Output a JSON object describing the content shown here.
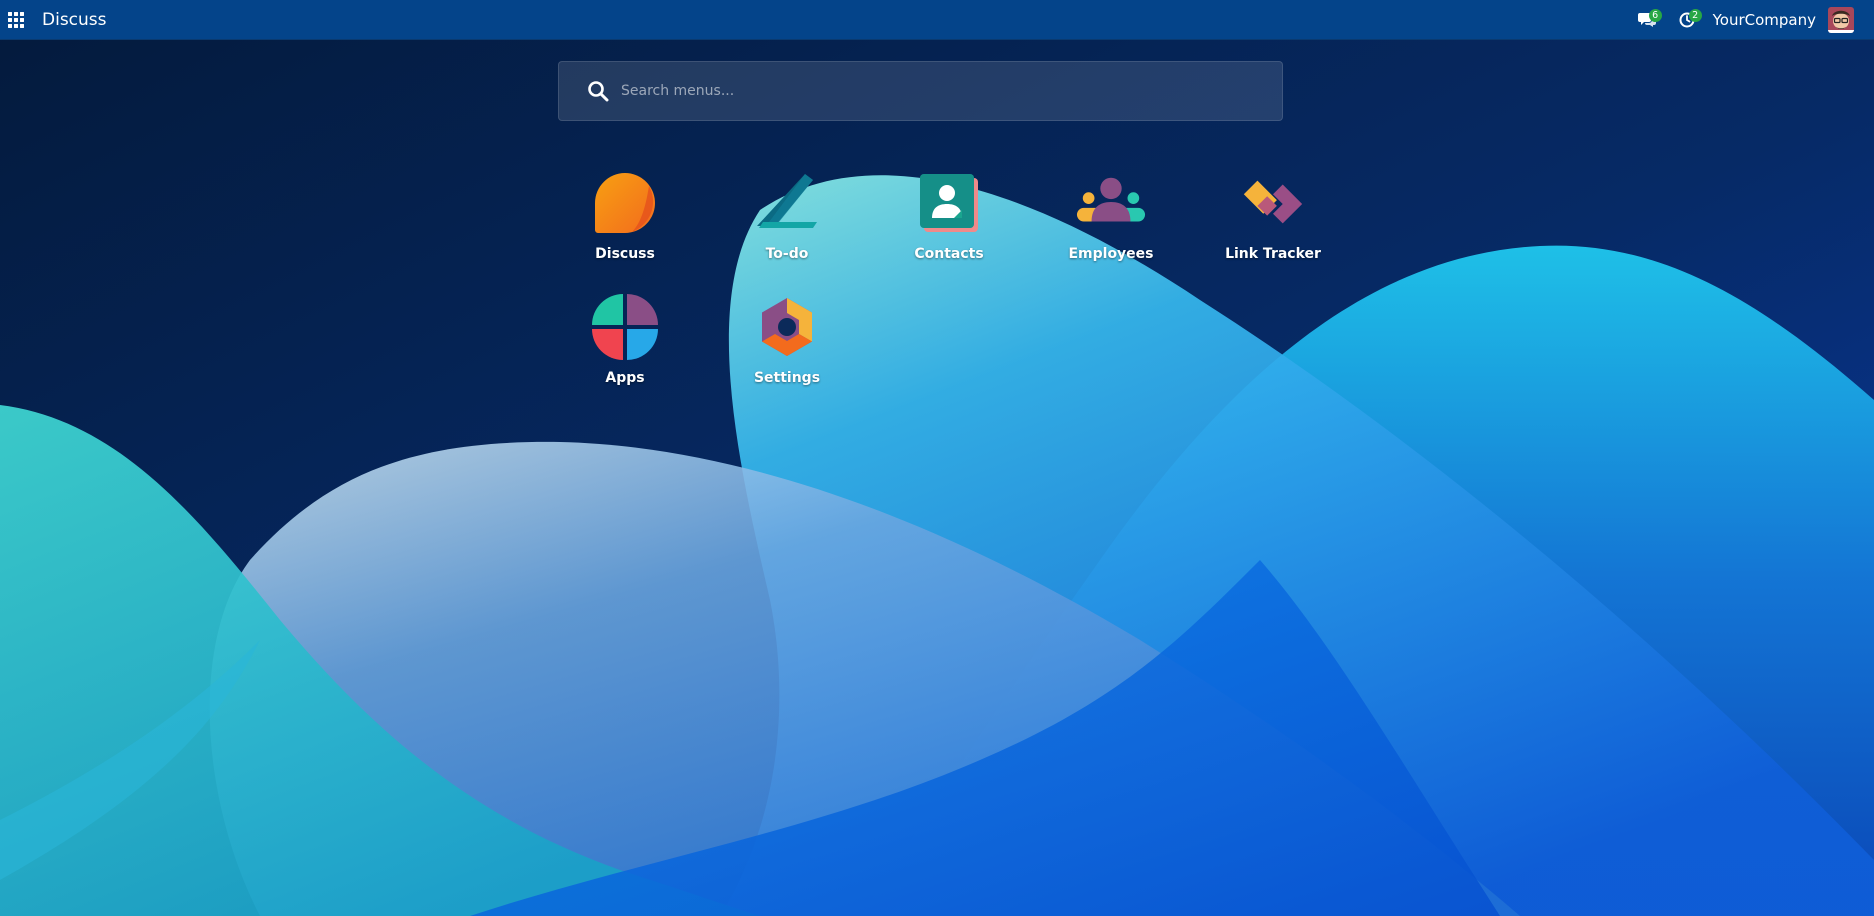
{
  "navbar": {
    "brand": "Discuss",
    "apps_icon": "grid-icon",
    "messages": {
      "icon": "comments-icon",
      "count": "6"
    },
    "activities": {
      "icon": "clock-icon",
      "count": "2"
    },
    "company": "YourCompany",
    "avatar": "user-avatar"
  },
  "search": {
    "placeholder": "Search menus...",
    "value": ""
  },
  "apps": [
    {
      "label": "Discuss",
      "icon": "discuss-icon"
    },
    {
      "label": "To-do",
      "icon": "todo-icon"
    },
    {
      "label": "Contacts",
      "icon": "contacts-icon"
    },
    {
      "label": "Employees",
      "icon": "employees-icon"
    },
    {
      "label": "Link Tracker",
      "icon": "link-tracker-icon"
    },
    {
      "label": "Apps",
      "icon": "apps-icon"
    },
    {
      "label": "Settings",
      "icon": "settings-icon"
    }
  ],
  "colors": {
    "navbar": "#04448a",
    "badge": "#28a745",
    "background_dark": "#04204a",
    "background_wave": "#1fa6e8"
  }
}
